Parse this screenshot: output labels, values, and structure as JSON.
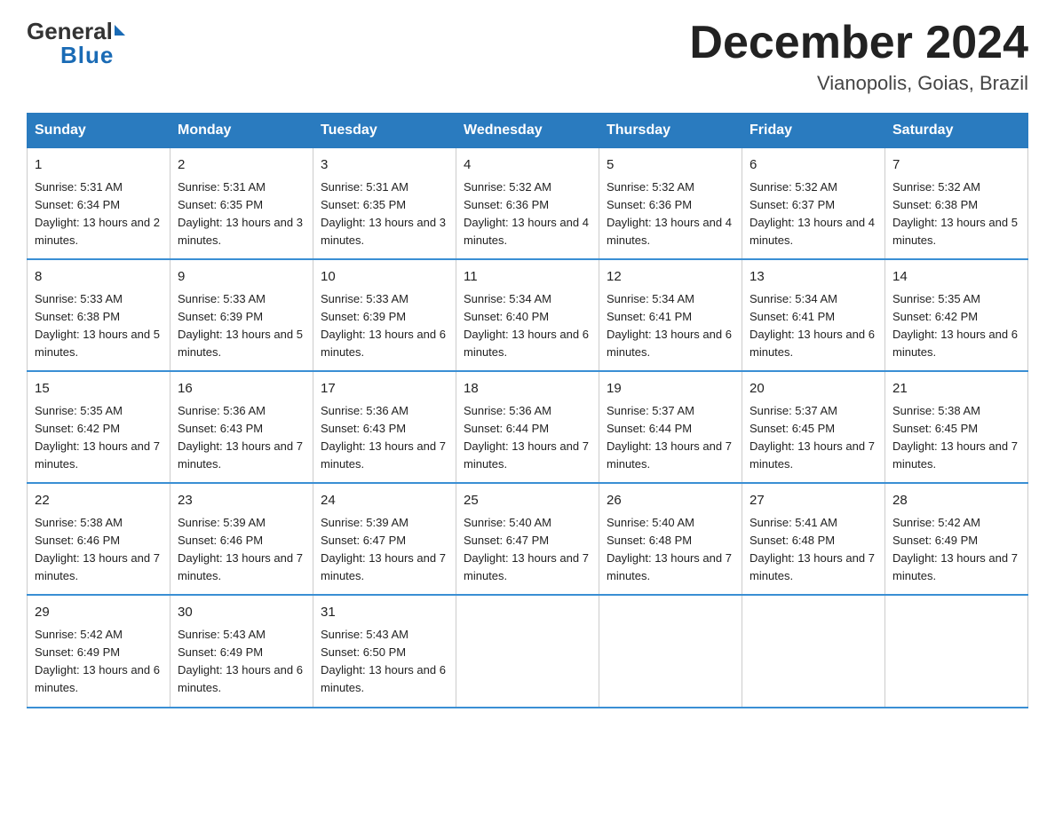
{
  "logo": {
    "general": "General",
    "blue": "Blue"
  },
  "title": "December 2024",
  "location": "Vianopolis, Goias, Brazil",
  "days_of_week": [
    "Sunday",
    "Monday",
    "Tuesday",
    "Wednesday",
    "Thursday",
    "Friday",
    "Saturday"
  ],
  "weeks": [
    [
      {
        "day": "1",
        "sunrise": "5:31 AM",
        "sunset": "6:34 PM",
        "daylight": "13 hours and 2 minutes."
      },
      {
        "day": "2",
        "sunrise": "5:31 AM",
        "sunset": "6:35 PM",
        "daylight": "13 hours and 3 minutes."
      },
      {
        "day": "3",
        "sunrise": "5:31 AM",
        "sunset": "6:35 PM",
        "daylight": "13 hours and 3 minutes."
      },
      {
        "day": "4",
        "sunrise": "5:32 AM",
        "sunset": "6:36 PM",
        "daylight": "13 hours and 4 minutes."
      },
      {
        "day": "5",
        "sunrise": "5:32 AM",
        "sunset": "6:36 PM",
        "daylight": "13 hours and 4 minutes."
      },
      {
        "day": "6",
        "sunrise": "5:32 AM",
        "sunset": "6:37 PM",
        "daylight": "13 hours and 4 minutes."
      },
      {
        "day": "7",
        "sunrise": "5:32 AM",
        "sunset": "6:38 PM",
        "daylight": "13 hours and 5 minutes."
      }
    ],
    [
      {
        "day": "8",
        "sunrise": "5:33 AM",
        "sunset": "6:38 PM",
        "daylight": "13 hours and 5 minutes."
      },
      {
        "day": "9",
        "sunrise": "5:33 AM",
        "sunset": "6:39 PM",
        "daylight": "13 hours and 5 minutes."
      },
      {
        "day": "10",
        "sunrise": "5:33 AM",
        "sunset": "6:39 PM",
        "daylight": "13 hours and 6 minutes."
      },
      {
        "day": "11",
        "sunrise": "5:34 AM",
        "sunset": "6:40 PM",
        "daylight": "13 hours and 6 minutes."
      },
      {
        "day": "12",
        "sunrise": "5:34 AM",
        "sunset": "6:41 PM",
        "daylight": "13 hours and 6 minutes."
      },
      {
        "day": "13",
        "sunrise": "5:34 AM",
        "sunset": "6:41 PM",
        "daylight": "13 hours and 6 minutes."
      },
      {
        "day": "14",
        "sunrise": "5:35 AM",
        "sunset": "6:42 PM",
        "daylight": "13 hours and 6 minutes."
      }
    ],
    [
      {
        "day": "15",
        "sunrise": "5:35 AM",
        "sunset": "6:42 PM",
        "daylight": "13 hours and 7 minutes."
      },
      {
        "day": "16",
        "sunrise": "5:36 AM",
        "sunset": "6:43 PM",
        "daylight": "13 hours and 7 minutes."
      },
      {
        "day": "17",
        "sunrise": "5:36 AM",
        "sunset": "6:43 PM",
        "daylight": "13 hours and 7 minutes."
      },
      {
        "day": "18",
        "sunrise": "5:36 AM",
        "sunset": "6:44 PM",
        "daylight": "13 hours and 7 minutes."
      },
      {
        "day": "19",
        "sunrise": "5:37 AM",
        "sunset": "6:44 PM",
        "daylight": "13 hours and 7 minutes."
      },
      {
        "day": "20",
        "sunrise": "5:37 AM",
        "sunset": "6:45 PM",
        "daylight": "13 hours and 7 minutes."
      },
      {
        "day": "21",
        "sunrise": "5:38 AM",
        "sunset": "6:45 PM",
        "daylight": "13 hours and 7 minutes."
      }
    ],
    [
      {
        "day": "22",
        "sunrise": "5:38 AM",
        "sunset": "6:46 PM",
        "daylight": "13 hours and 7 minutes."
      },
      {
        "day": "23",
        "sunrise": "5:39 AM",
        "sunset": "6:46 PM",
        "daylight": "13 hours and 7 minutes."
      },
      {
        "day": "24",
        "sunrise": "5:39 AM",
        "sunset": "6:47 PM",
        "daylight": "13 hours and 7 minutes."
      },
      {
        "day": "25",
        "sunrise": "5:40 AM",
        "sunset": "6:47 PM",
        "daylight": "13 hours and 7 minutes."
      },
      {
        "day": "26",
        "sunrise": "5:40 AM",
        "sunset": "6:48 PM",
        "daylight": "13 hours and 7 minutes."
      },
      {
        "day": "27",
        "sunrise": "5:41 AM",
        "sunset": "6:48 PM",
        "daylight": "13 hours and 7 minutes."
      },
      {
        "day": "28",
        "sunrise": "5:42 AM",
        "sunset": "6:49 PM",
        "daylight": "13 hours and 7 minutes."
      }
    ],
    [
      {
        "day": "29",
        "sunrise": "5:42 AM",
        "sunset": "6:49 PM",
        "daylight": "13 hours and 6 minutes."
      },
      {
        "day": "30",
        "sunrise": "5:43 AM",
        "sunset": "6:49 PM",
        "daylight": "13 hours and 6 minutes."
      },
      {
        "day": "31",
        "sunrise": "5:43 AM",
        "sunset": "6:50 PM",
        "daylight": "13 hours and 6 minutes."
      },
      null,
      null,
      null,
      null
    ]
  ]
}
